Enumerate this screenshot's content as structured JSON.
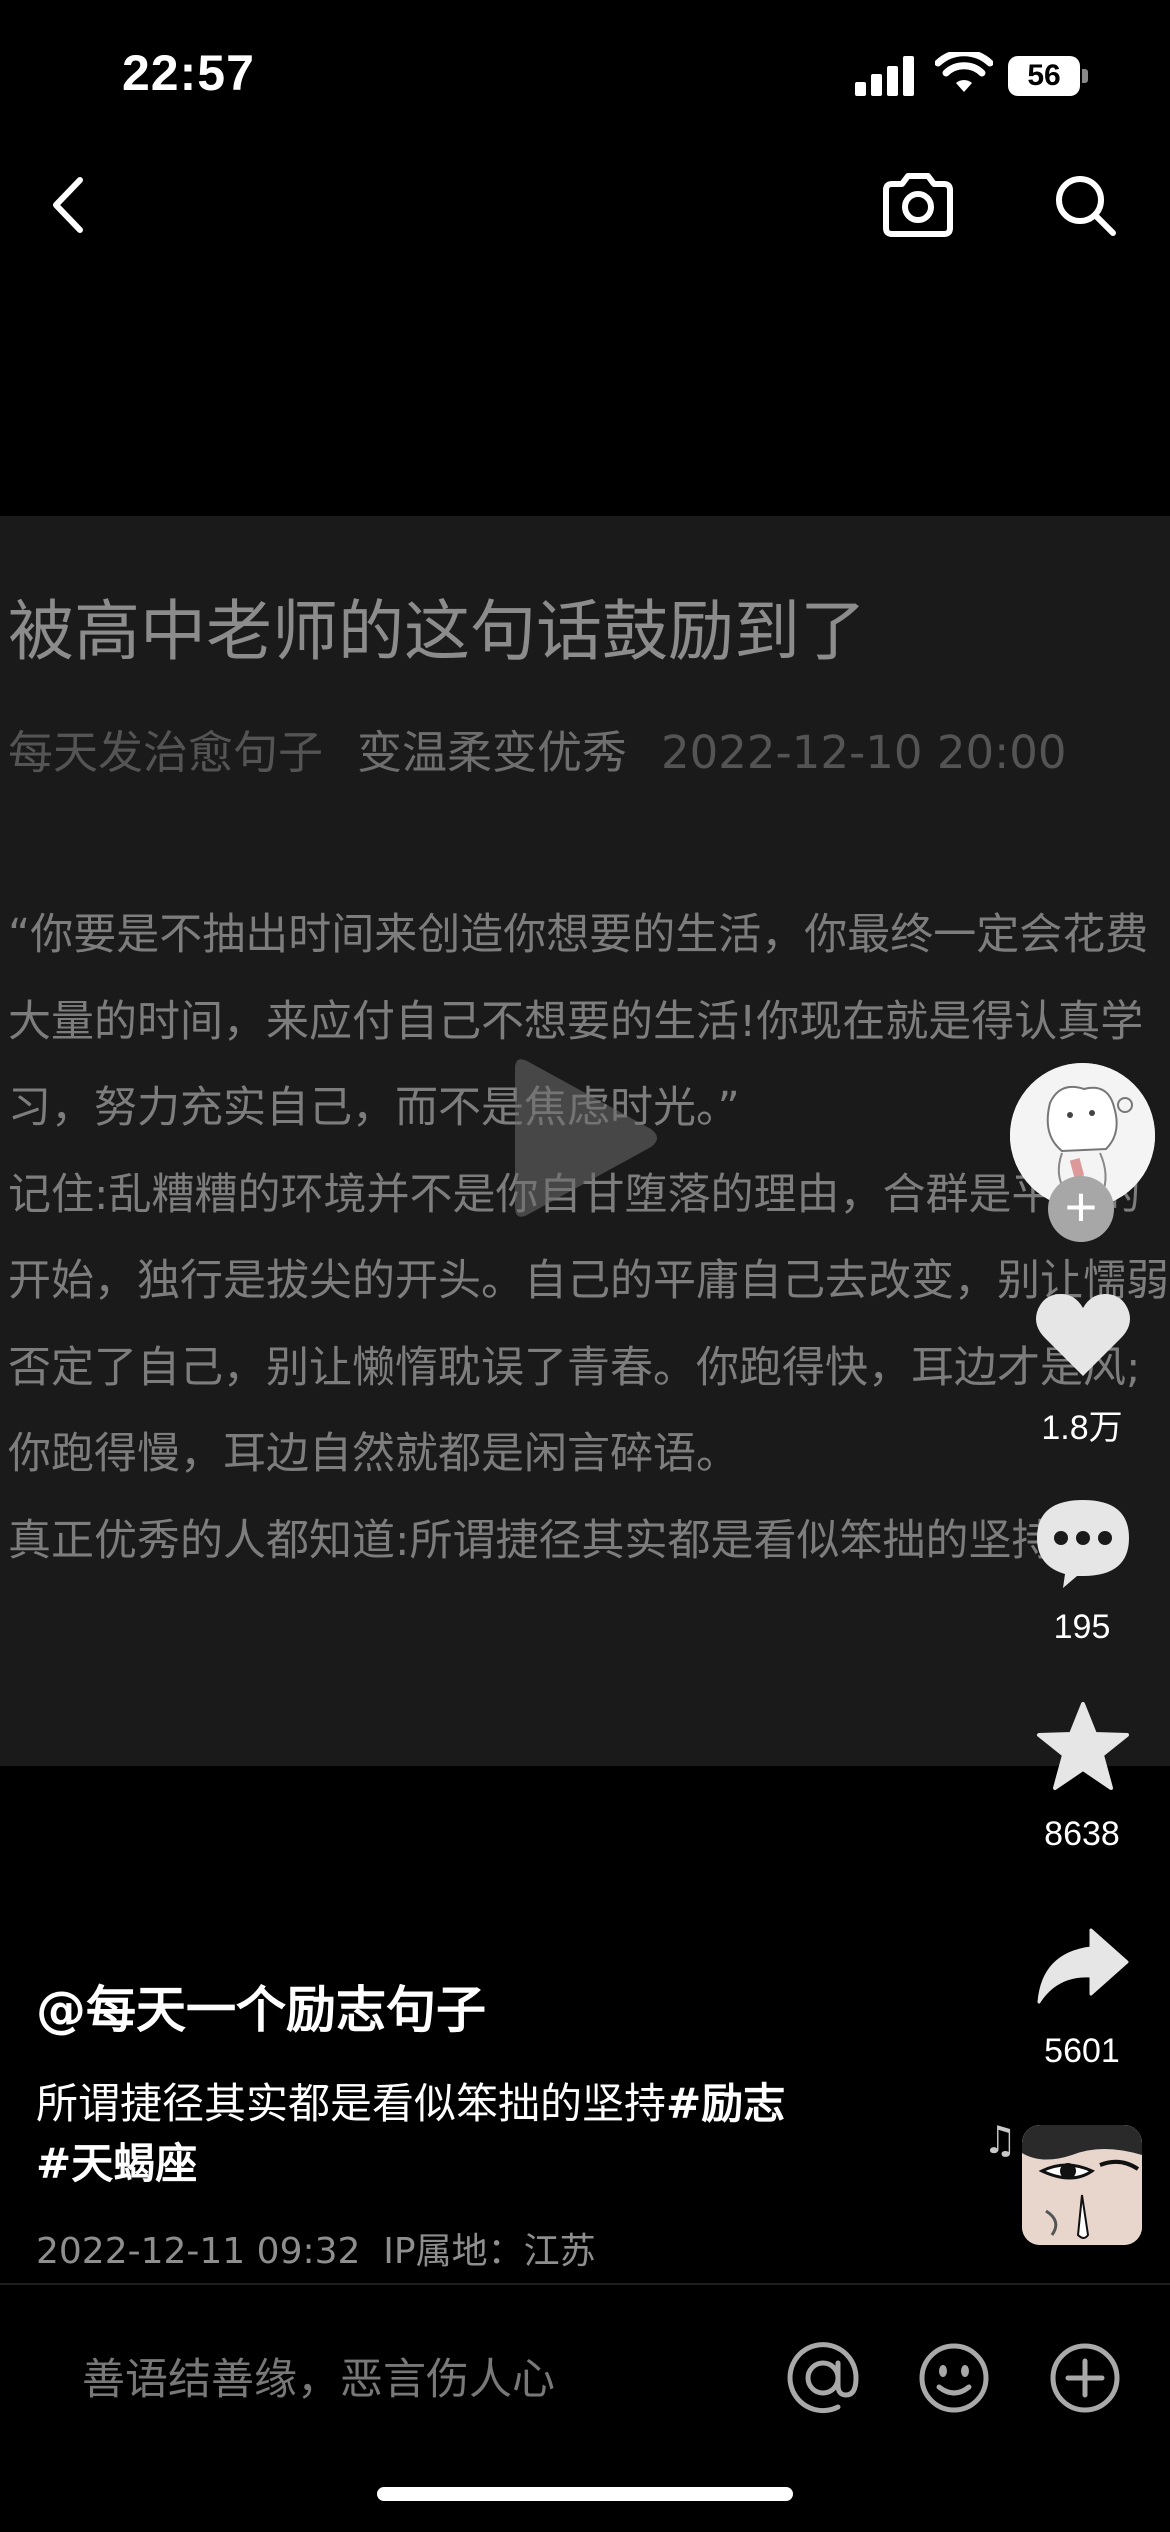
{
  "status_bar": {
    "time": "22:57",
    "battery": "56"
  },
  "article": {
    "title": "被高中老师的这句话鼓励到了",
    "author": "每天发治愈句子",
    "tag": "变温柔变优秀",
    "datetime": "2022-12-10 20:00",
    "paragraphs": [
      "“你要是不抽出时间来创造你想要的生活，你最终一定会花费大量的时间，来应付自己不想要的生活!你现在就是得认真学习，努力充实自己，而不是焦虑时光。”",
      "记住:乱糟糟的环境并不是你自甘堕落的理由，合群是平凡的开始，独行是拔尖的开头。自己的平庸自己去改变，别让懦弱否定了自己，别让懒惰耽误了青春。你跑得快，耳边才是风;你跑得慢，耳边自然就都是闲言碎语。",
      "真正优秀的人都知道:所谓捷径其实都是看似笨拙的坚持。"
    ]
  },
  "rail": {
    "likes": "1.8万",
    "comments": "195",
    "favorites": "8638",
    "shares": "5601"
  },
  "caption": {
    "username": "@每天一个励志句子",
    "text": "所谓捷径其实都是看似笨拙的坚持",
    "hashtag1": "#励志",
    "hashtag2": "#天蝎座",
    "post_time": "2022-12-11 09:32",
    "ip_location": "IP属地：江苏"
  },
  "comment_bar": {
    "placeholder": "善语结善缘，恶言伤人心"
  },
  "icons": {
    "back": "chevron-left-icon",
    "camera": "camera-icon",
    "search": "search-icon",
    "play": "play-icon",
    "like": "heart-icon",
    "comment": "comment-bubble-icon",
    "favorite": "star-icon",
    "share": "share-arrow-icon",
    "mention": "at-icon",
    "emoji": "emoji-icon",
    "add": "plus-circle-icon",
    "music": "music-note-icon"
  }
}
